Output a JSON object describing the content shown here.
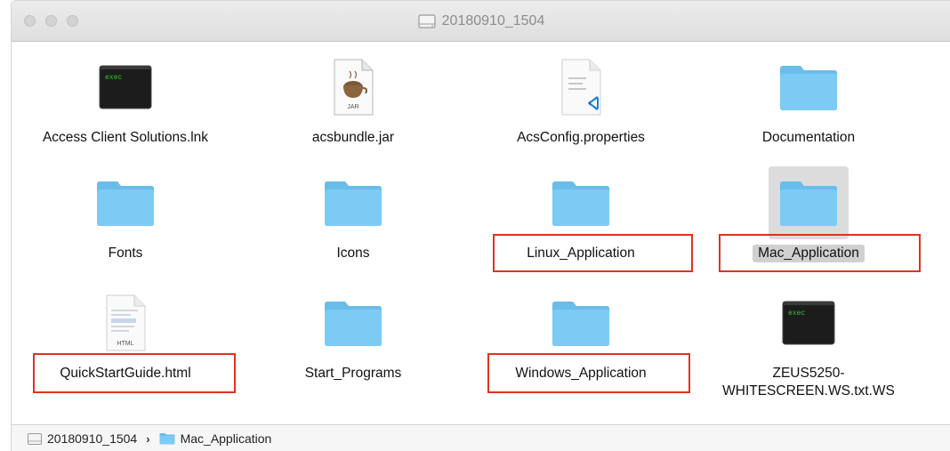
{
  "window": {
    "title": "20180910_1504",
    "title_icon": "disk-icon",
    "traffic_lights": [
      "close",
      "minimize",
      "zoom"
    ]
  },
  "items": [
    {
      "name": "Access Client Solutions.lnk",
      "icon": "exec-icon",
      "icon_text": "exec"
    },
    {
      "name": "acsbundle.jar",
      "icon": "jar-icon",
      "icon_text": "JAR"
    },
    {
      "name": "AcsConfig.properties",
      "icon": "properties-file-icon"
    },
    {
      "name": "Documentation",
      "icon": "folder-icon"
    },
    {
      "name": "Fonts",
      "icon": "folder-icon"
    },
    {
      "name": "Icons",
      "icon": "folder-icon"
    },
    {
      "name": "Linux_Application",
      "icon": "folder-icon",
      "highlighted": true
    },
    {
      "name": "Mac_Application",
      "icon": "folder-icon",
      "highlighted": true,
      "selected": true
    },
    {
      "name": "QuickStartGuide.html",
      "icon": "html-file-icon",
      "icon_text": "HTML",
      "highlighted": true
    },
    {
      "name": "Start_Programs",
      "icon": "folder-icon"
    },
    {
      "name": "Windows_Application",
      "icon": "folder-icon",
      "highlighted": true
    },
    {
      "name_line1": "ZEUS5250-",
      "name_line2": "WHITESCREEN.WS.txt.WS",
      "icon": "exec-icon",
      "icon_text": "exec"
    }
  ],
  "path_bar": {
    "segments": [
      "20180910_1504",
      "Mac_Application"
    ],
    "separator": "›"
  },
  "colors": {
    "folder": "#7ccbf5",
    "folder_tab": "#68bdeb",
    "highlight_box": "#e0331e",
    "selection": "#d0d0d0",
    "exec_text": "#39c13c"
  }
}
